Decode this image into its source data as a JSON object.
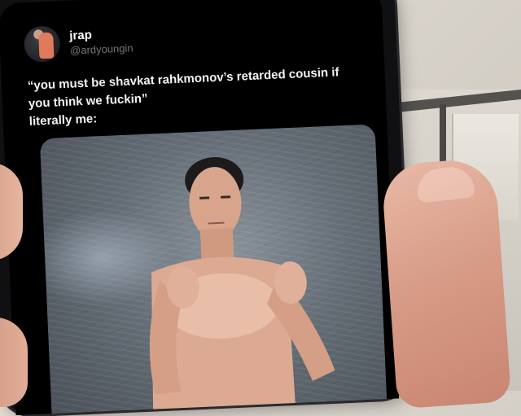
{
  "tweet": {
    "display_name": "jrap",
    "handle": "@ardyoungin",
    "text_line1": "“you must be shavkat rahkmonov’s retarded cousin if",
    "text_line2": "you think we fuckin”",
    "text_line3": "literally me:",
    "avatar_icon": "profile-avatar",
    "media_description_icon": "fighter-photo"
  },
  "colors": {
    "screen_bg": "#000000",
    "text_primary": "#f2f2f2",
    "text_secondary": "#71767b"
  }
}
